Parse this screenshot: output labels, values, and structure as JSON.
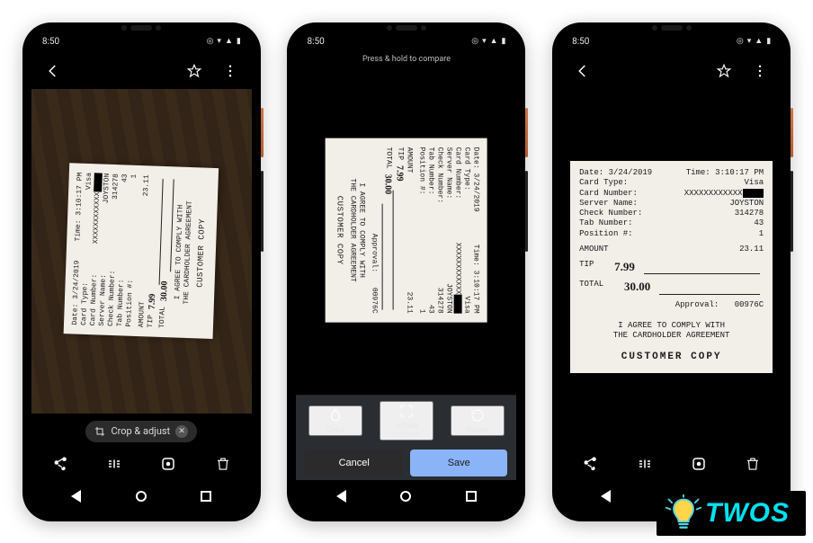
{
  "status": {
    "time": "8:50"
  },
  "photo_header": {
    "hint": "Press & hold to compare"
  },
  "chip": {
    "label": "Crop & adjust"
  },
  "tools": {
    "color": "Color",
    "adjust": "Adjust corners",
    "rotate": "Rotate"
  },
  "buttons": {
    "cancel": "Cancel",
    "save": "Save"
  },
  "receipt": {
    "date_label": "Date:",
    "date": "3/24/2019",
    "time_label": "Time:",
    "time": "3:10:17 PM",
    "card_type_label": "Card Type:",
    "card_type": "Visa",
    "card_number_label": "Card Number:",
    "card_number": "XXXXXXXXXXXX",
    "server_label": "Server Name:",
    "server": "JOYSTON",
    "check_label": "Check Number:",
    "check": "314278",
    "tab_label": "Tab Number:",
    "tab": "43",
    "position_label": "Position #:",
    "position": "1",
    "amount_label": "AMOUNT",
    "amount": "23.11",
    "tip_label": "TIP",
    "tip": "7.99",
    "total_label": "TOTAL",
    "total": "30.00",
    "approval_label": "Approval:",
    "approval": "00976C",
    "agree1": "I AGREE TO COMPLY WITH",
    "agree2": "THE CARDHOLDER AGREEMENT",
    "footer": "CUSTOMER  COPY"
  },
  "brand": {
    "name": "TWOS"
  }
}
